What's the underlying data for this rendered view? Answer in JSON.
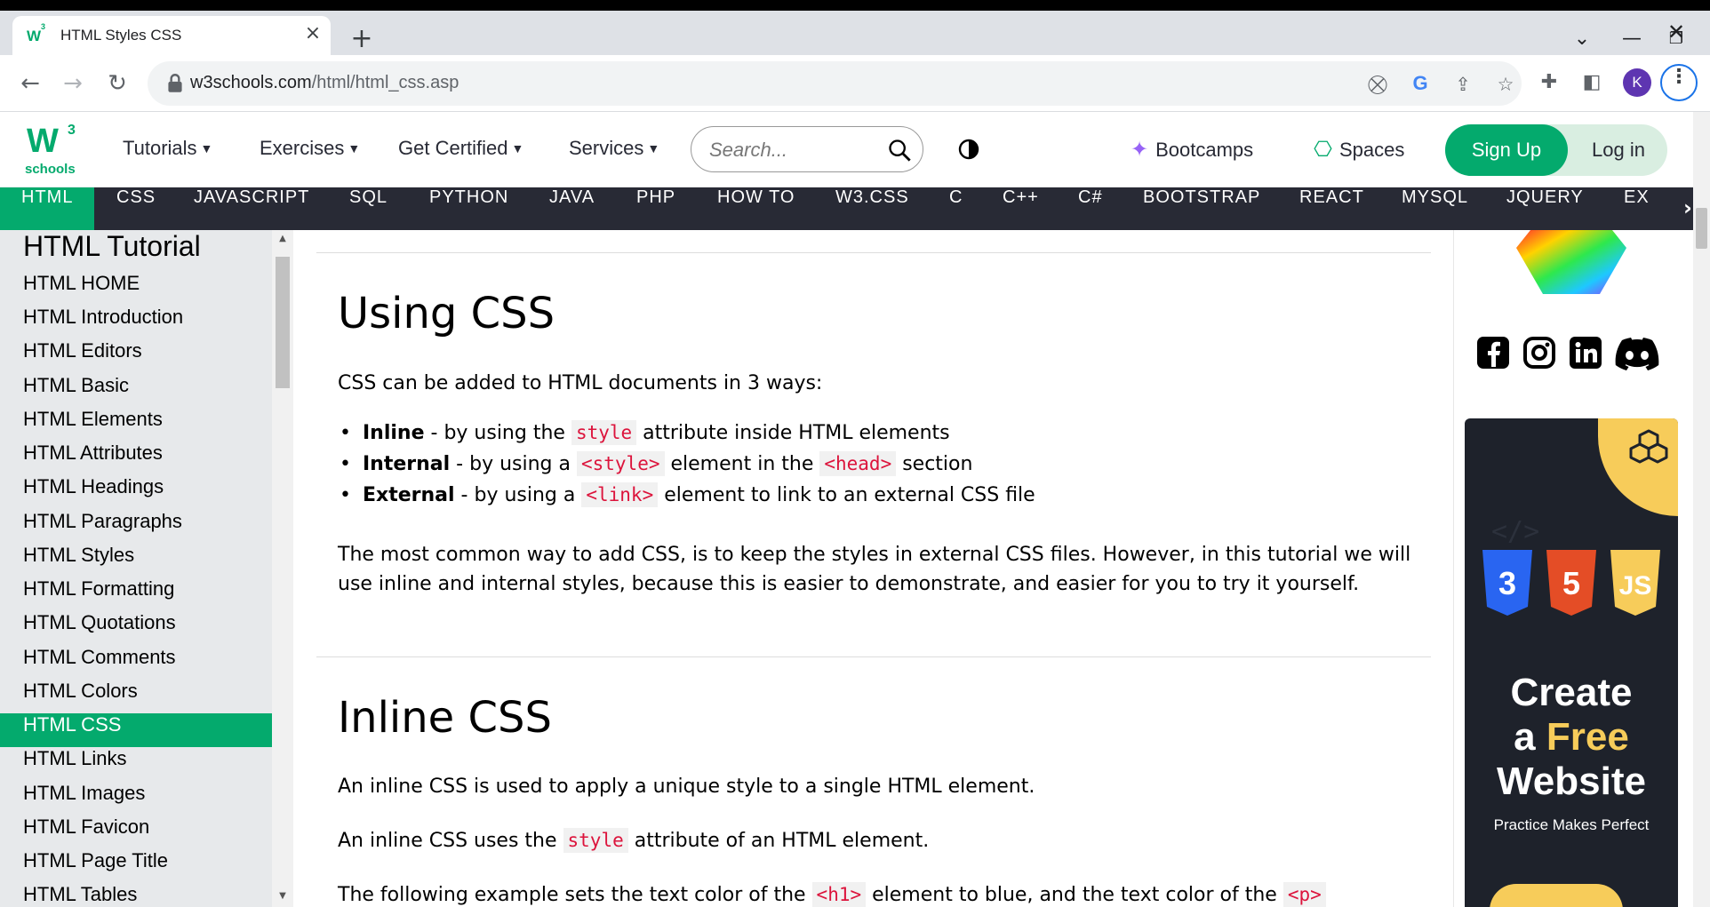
{
  "browser": {
    "tab_title": "HTML Styles CSS",
    "tab_favicon": "w3",
    "url_domain": "w3schools.com",
    "url_path": "/html/html_css.asp",
    "avatar_letter": "K"
  },
  "header": {
    "logo_text": "w3",
    "logo_sup": "3",
    "logo_sub": "schools",
    "menu": [
      {
        "label": "Tutorials"
      },
      {
        "label": "Exercises"
      },
      {
        "label": "Get Certified"
      },
      {
        "label": "Services"
      }
    ],
    "search_placeholder": "Search...",
    "bootcamps": "Bootcamps",
    "spaces": "Spaces",
    "signup": "Sign Up",
    "login": "Log in"
  },
  "langnav": {
    "items": [
      "HTML",
      "CSS",
      "JAVASCRIPT",
      "SQL",
      "PYTHON",
      "JAVA",
      "PHP",
      "HOW TO",
      "W3.CSS",
      "C",
      "C++",
      "C#",
      "BOOTSTRAP",
      "REACT",
      "MYSQL",
      "JQUERY",
      "EX"
    ],
    "active": "HTML"
  },
  "sidebar": {
    "title": "HTML Tutorial",
    "items": [
      "HTML HOME",
      "HTML Introduction",
      "HTML Editors",
      "HTML Basic",
      "HTML Elements",
      "HTML Attributes",
      "HTML Headings",
      "HTML Paragraphs",
      "HTML Styles",
      "HTML Formatting",
      "HTML Quotations",
      "HTML Comments",
      "HTML Colors",
      "HTML CSS",
      "HTML Links",
      "HTML Images",
      "HTML Favicon",
      "HTML Page Title",
      "HTML Tables"
    ],
    "active": "HTML CSS"
  },
  "content": {
    "h_using": "Using CSS",
    "p_ways": "CSS can be added to HTML documents in 3 ways:",
    "bullets": [
      {
        "bold": "Inline",
        "pre": " - by using the ",
        "code": "style",
        "post": " attribute inside HTML elements"
      },
      {
        "bold": "Internal",
        "pre": " - by using a ",
        "code": "<style>",
        "mid": " element in the ",
        "code2": "<head>",
        "post": " section"
      },
      {
        "bold": "External",
        "pre": " - by using a ",
        "code": "<link>",
        "post": " element to link to an external CSS file"
      }
    ],
    "p_common": "The most common way to add CSS, is to keep the styles in external CSS files. However, in this tutorial we will use inline and internal styles, because this is easier to demonstrate, and easier for you to try it yourself.",
    "h_inline": "Inline CSS",
    "p_inline1": "An inline CSS is used to apply a unique style to a single HTML element.",
    "p_inline2_pre": "An inline CSS uses the ",
    "p_inline2_code": "style",
    "p_inline2_post": " attribute of an HTML element.",
    "p_inline3_pre": "The following example sets the text color of the ",
    "p_inline3_code": "<h1>",
    "p_inline3_mid": " element to blue, and the text color of the ",
    "p_inline3_code2": "<p>"
  },
  "ad": {
    "line1": "Create",
    "line2a": "a ",
    "line2b": "Free",
    "line3": "Website",
    "sub": "Practice Makes Perfect"
  },
  "colors": {
    "brand": "#04aa6d",
    "nav_bg": "#282a35",
    "sidebar_bg": "#e7e9eb",
    "code_red": "#dc143c"
  }
}
